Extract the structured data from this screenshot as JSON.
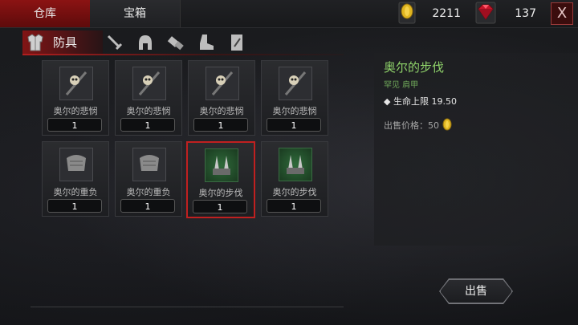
{
  "tabs": {
    "warehouse": "仓库",
    "chest": "宝箱"
  },
  "resources": {
    "gold": "2211",
    "gems": "137"
  },
  "close_label": "X",
  "category": {
    "active_label": "防具"
  },
  "items": [
    {
      "name": "奥尔的悲悯",
      "count": "1",
      "icon": "skull-amulet-icon"
    },
    {
      "name": "奥尔的悲悯",
      "count": "1",
      "icon": "skull-amulet-icon"
    },
    {
      "name": "奥尔的悲悯",
      "count": "1",
      "icon": "skull-amulet-icon"
    },
    {
      "name": "奥尔的悲悯",
      "count": "1",
      "icon": "skull-amulet-icon"
    },
    {
      "name": "奥尔的重负",
      "count": "1",
      "icon": "pauldron-icon"
    },
    {
      "name": "奥尔的重负",
      "count": "1",
      "icon": "pauldron-icon"
    },
    {
      "name": "奥尔的步伐",
      "count": "1",
      "icon": "spiked-shoulder-icon"
    },
    {
      "name": "奥尔的步伐",
      "count": "1",
      "icon": "spiked-shoulder-icon"
    }
  ],
  "detail": {
    "title": "奥尔的步伐",
    "subtitle": "罕见 肩甲",
    "stat": "◆ 生命上限 19.50",
    "price_label": "出售价格：50"
  },
  "sell_label": "出售",
  "colors": {
    "accent_red": "#8b1313",
    "rare_green": "#8fd36a"
  }
}
